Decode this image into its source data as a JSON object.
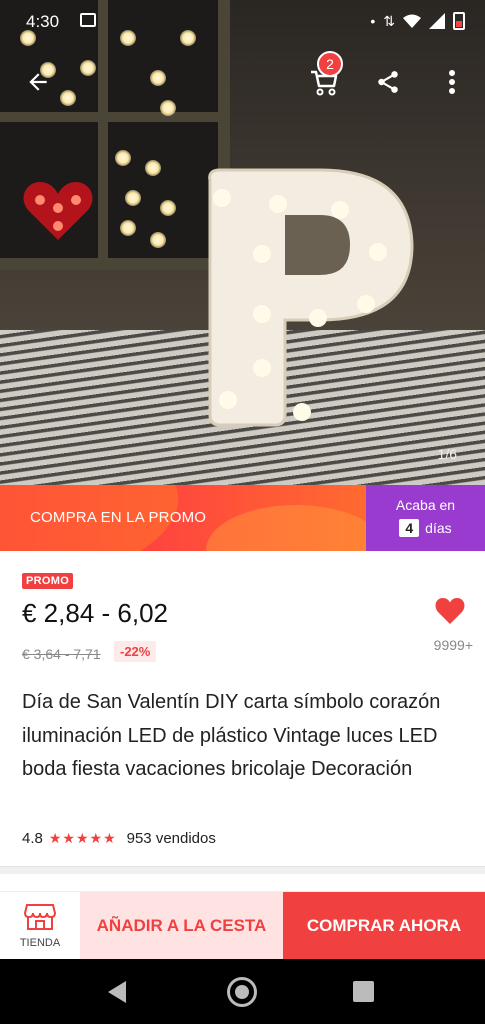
{
  "status_bar": {
    "time": "4:30"
  },
  "topbar": {
    "cart_count": "2"
  },
  "gallery": {
    "counter": "1/6"
  },
  "promo_banner": {
    "left_text": "COMPRA EN LA PROMO",
    "ends_in": "Acaba en",
    "days_value": "4",
    "days_label": "días"
  },
  "product": {
    "promo_tag": "PROMO",
    "price": "€ 2,84 - 6,02",
    "old_price": "€ 3,64 - 7,71",
    "discount": "-22%",
    "wishlist_count": "9999+",
    "title": "Día de San Valentín DIY carta símbolo corazón iluminación LED de plástico Vintage luces LED boda fiesta vacaciones bricolaje Decoración",
    "rating": "4.8",
    "stars": "★★★★★",
    "sold": "953 vendidos"
  },
  "actions": {
    "store_label": "TIENDA",
    "add_to_cart": "AÑADIR A LA CESTA",
    "buy_now": "COMPRAR AHORA"
  },
  "colors": {
    "accent": "#f04040",
    "promo_purple": "#9a3bd0"
  }
}
